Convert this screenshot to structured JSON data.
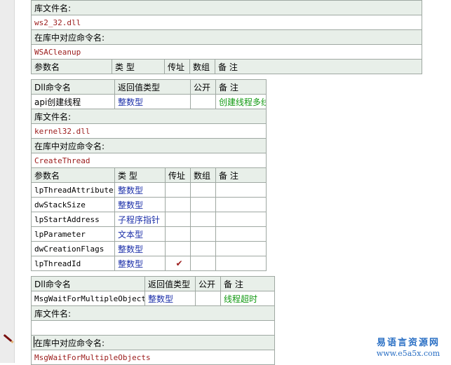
{
  "labels": {
    "lib_file": "库文件名:",
    "cmd_in_lib": "在库中对应命令名:",
    "param_name": "参数名",
    "type": "类 型",
    "by_ref": "传址",
    "array": "数组",
    "note": "备 注",
    "dll_cmd": "Dll命令名",
    "ret_type": "返回值类型",
    "public": "公开"
  },
  "block1": {
    "lib_file": "ws2_32.dll",
    "lib_cmd": "WSACleanup"
  },
  "block2": {
    "name": "api创建线程",
    "return_type": "整数型",
    "note": "创建线程多线程类",
    "lib_file": "kernel32.dll",
    "lib_cmd": "CreateThread",
    "params": [
      {
        "name": "lpThreadAttributes",
        "type": "整数型",
        "by_ref": ""
      },
      {
        "name": "dwStackSize",
        "type": "整数型",
        "by_ref": ""
      },
      {
        "name": "lpStartAddress",
        "type": "子程序指针",
        "by_ref": ""
      },
      {
        "name": "lpParameter",
        "type": "文本型",
        "by_ref": ""
      },
      {
        "name": "dwCreationFlags",
        "type": "整数型",
        "by_ref": ""
      },
      {
        "name": "lpThreadId",
        "type": "整数型",
        "by_ref": "✔"
      }
    ]
  },
  "block3": {
    "name": "MsgWaitForMultipleObjects",
    "return_type": "整数型",
    "note": "线程超时",
    "lib_file": "",
    "lib_cmd": "MsgWaitForMultipleObjects"
  },
  "watermark": {
    "line1": "易语言资源网",
    "line2": "www.e5a5x.com"
  }
}
